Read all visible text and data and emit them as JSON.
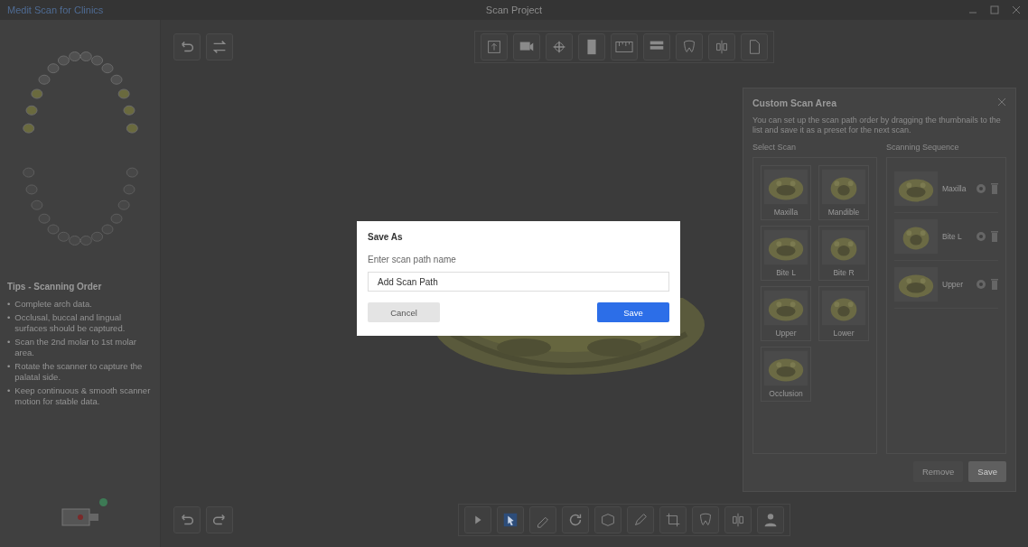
{
  "window": {
    "title": "Medit Scan for Clinics",
    "document_title": "Scan Project"
  },
  "tips": {
    "title": "Tips - Scanning Order",
    "items": [
      {
        "marker": "•",
        "text": "Complete arch data."
      },
      {
        "marker": "•",
        "text": "Occlusal, buccal and lingual surfaces should be captured."
      },
      {
        "marker": "•",
        "text": "Scan the 2nd molar to 1st molar area."
      },
      {
        "marker": "•",
        "text": "Rotate the scanner to capture the palatal side."
      },
      {
        "marker": "•",
        "text": "Keep continuous & smooth scanner motion for stable data."
      }
    ]
  },
  "dialog": {
    "title": "Save As",
    "prompt": "Enter scan path name",
    "value": "Add Scan Path",
    "buttons": [
      {
        "label": "Cancel",
        "kind": "secondary"
      },
      {
        "label": "Save",
        "kind": "primary"
      }
    ]
  },
  "scan_panel": {
    "title": "Custom Scan Area",
    "description": "You can set up the scan path order by dragging the thumbnails to the list and save it as a preset for the next scan.",
    "select_header": "Select Scan",
    "sequence_header": "Scanning Sequence",
    "thumbnails": [
      {
        "label": "Maxilla"
      },
      {
        "label": "Mandible"
      },
      {
        "label": "Bite L"
      },
      {
        "label": "Bite R"
      },
      {
        "label": "Upper"
      },
      {
        "label": "Lower"
      },
      {
        "label": "Occlusion"
      }
    ],
    "sequence": [
      {
        "label": "Maxilla"
      },
      {
        "label": "Bite L"
      },
      {
        "label": "Upper"
      }
    ],
    "buttons": [
      {
        "label": "Remove",
        "kind": "secondary"
      },
      {
        "label": "Save",
        "kind": "primary"
      }
    ]
  }
}
